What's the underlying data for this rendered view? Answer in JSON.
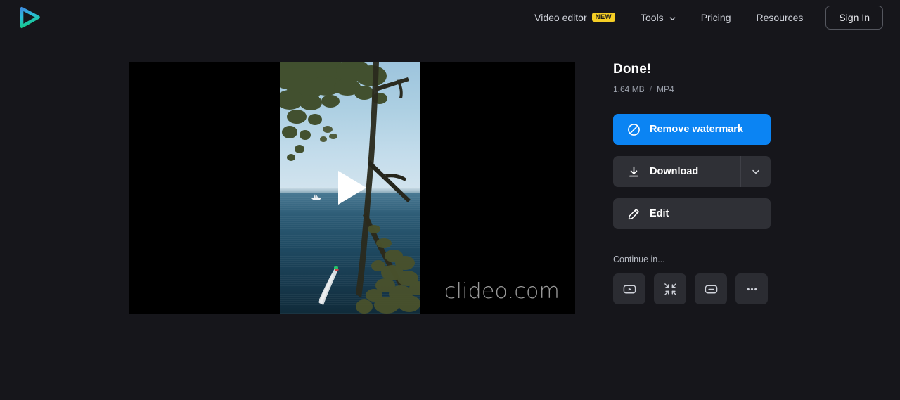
{
  "header": {
    "logo_name": "clideo-play-logo",
    "nav": [
      {
        "label": "Video editor",
        "badge": "NEW",
        "name": "nav-video-editor"
      },
      {
        "label": "Tools",
        "has_chevron": true,
        "name": "nav-tools"
      },
      {
        "label": "Pricing",
        "name": "nav-pricing"
      },
      {
        "label": "Resources",
        "name": "nav-resources"
      }
    ],
    "sign_in_label": "Sign In"
  },
  "player": {
    "watermark": "clideo.com",
    "play_label": "Play"
  },
  "panel": {
    "title": "Done!",
    "file_size": "1.64 MB",
    "separator": "/",
    "file_format": "MP4",
    "remove_watermark_label": "Remove watermark",
    "download_label": "Download",
    "edit_label": "Edit",
    "continue_label": "Continue in...",
    "continue_items": [
      {
        "name": "continue-video-tool",
        "icon": "video-play-rect-icon"
      },
      {
        "name": "continue-compress-tool",
        "icon": "compress-arrows-icon"
      },
      {
        "name": "continue-subtitle-tool",
        "icon": "subtitle-box-icon"
      },
      {
        "name": "continue-more-tools",
        "icon": "ellipsis-icon"
      }
    ]
  },
  "colors": {
    "page_background": "#16161b",
    "accent_blue": "#0b84f3",
    "badge_yellow": "#f5ce25",
    "button_dark": "#2f3036",
    "icon_button": "#2b2c32"
  }
}
